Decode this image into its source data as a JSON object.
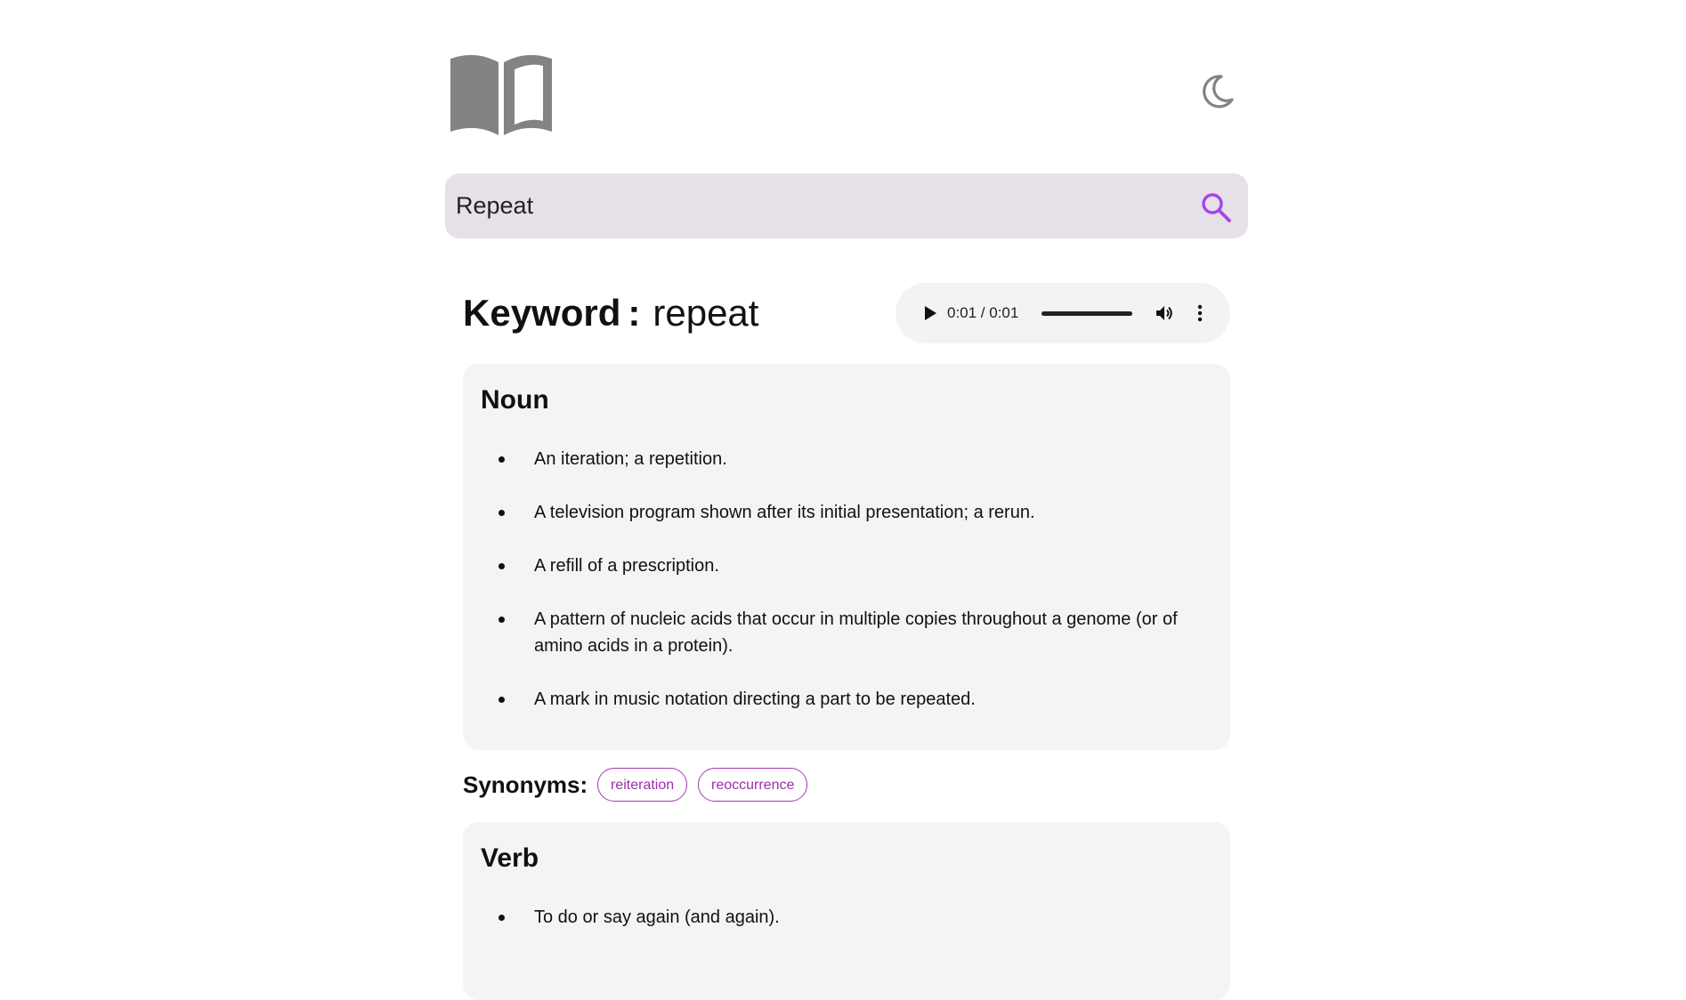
{
  "search": {
    "value": "Repeat",
    "placeholder": ""
  },
  "keyword": {
    "label": "Keyword",
    "separator": ":",
    "value": "repeat"
  },
  "audio": {
    "time": "0:01 / 0:01",
    "progress_fraction": 1.0
  },
  "noun": {
    "title": "Noun",
    "definitions": [
      "An iteration; a repetition.",
      "A television program shown after its initial presentation; a rerun.",
      "A refill of a prescription.",
      "A pattern of nucleic acids that occur in multiple copies throughout a genome (or of amino acids in a protein).",
      "A mark in music notation directing a part to be repeated."
    ]
  },
  "synonyms": {
    "label": "Synonyms:",
    "items": [
      "reiteration",
      "reoccurrence"
    ]
  },
  "verb": {
    "title": "Verb",
    "definitions": [
      "To do or say again (and again)."
    ]
  },
  "icons": {
    "logo": "book-icon",
    "theme": "moon-icon",
    "search": "search-icon",
    "play": "play-icon",
    "volume": "volume-icon",
    "more": "more-vert-icon"
  },
  "colors": {
    "accent": "#a445ed",
    "chip": "#9b2fa8",
    "search_bg": "#e6e1e8",
    "card_bg": "#f4f4f4",
    "icon_gray": "#838383"
  }
}
